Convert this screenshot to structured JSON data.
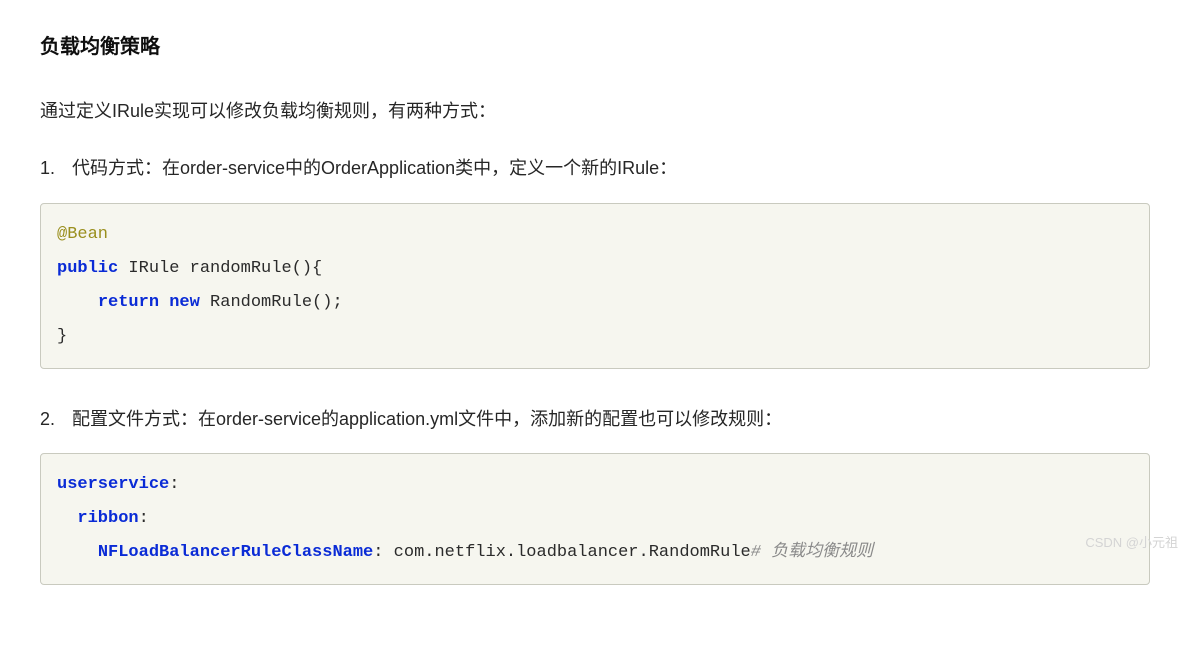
{
  "heading": "负载均衡策略",
  "intro": "通过定义IRule实现可以修改负载均衡规则，有两种方式：",
  "item1": {
    "num": "1.",
    "text": "代码方式：在order-service中的OrderApplication类中，定义一个新的IRule："
  },
  "code1": {
    "l1_annotation": "@Bean",
    "l2_kw_public": "public",
    "l2_rest": " IRule randomRule(){",
    "l3_indent": "    ",
    "l3_kw_return": "return",
    "l3_space": " ",
    "l3_kw_new": "new",
    "l3_rest": " RandomRule();",
    "l4": "}"
  },
  "item2": {
    "num": "2.",
    "text": "配置文件方式：在order-service的application.yml文件中，添加新的配置也可以修改规则："
  },
  "code2": {
    "l1_key": "userservice",
    "l1_colon": ":",
    "l2_indent": "  ",
    "l2_key": "ribbon",
    "l2_colon": ":",
    "l3_indent": "    ",
    "l3_key": "NFLoadBalancerRuleClassName",
    "l3_colon": ": ",
    "l3_val": "com.netflix.loadbalancer.RandomRule",
    "l3_comment": "# 负载均衡规则"
  },
  "watermark": "CSDN @小元祖"
}
